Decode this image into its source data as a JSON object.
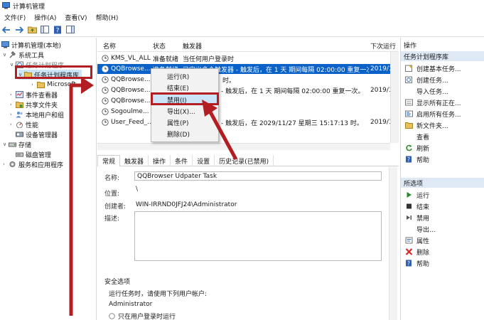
{
  "window": {
    "title": "计算机管理"
  },
  "menu": [
    "文件(F)",
    "操作(A)",
    "查看(V)",
    "帮助(H)"
  ],
  "tree": {
    "root": "计算机管理(本地)",
    "system_tools": "系统工具",
    "task_scheduler": "任务计划程序",
    "task_library": "任务计划程序库",
    "microsoft": "Microsoft",
    "event_viewer": "事件查看器",
    "shared_folders": "共享文件夹",
    "local_users": "本地用户和组",
    "performance": "性能",
    "device_manager": "设备管理器",
    "storage": "存储",
    "disk_management": "磁盘管理",
    "services_apps": "服务和应用程序"
  },
  "task_list": {
    "headers": [
      "名称",
      "状态",
      "触发器",
      "下次运行"
    ],
    "rows": [
      {
        "name": "KMS_VL_ALL",
        "status": "准备就绪",
        "trigger": "当任何用户登录时",
        "next": ""
      },
      {
        "name": "QQBrowse...",
        "status": "准备就绪",
        "trigger": "已定义多个触发器 - 触发后，在 1 天 期间每隔 02:00:00 重复一次。",
        "next": "2019/11"
      },
      {
        "name": "QQBrowse...",
        "status": "",
        "trigger": "",
        "next": ""
      },
      {
        "name": "QQBrowse...",
        "status": "",
        "trigger": "- 触发后，在 1 天 期间每隔 02:00:00 重复一次。",
        "next": "2019/11"
      },
      {
        "name": "QQBrowse...",
        "status": "",
        "trigger": "",
        "next": ""
      },
      {
        "name": "Sogoulme...",
        "status": "",
        "trigger": "",
        "next": ""
      },
      {
        "name": "User_Feed_...",
        "status": "",
        "trigger": "- 触发后，在 2029/11/27 星期三 15:17:13 时。",
        "next": "2019/11"
      }
    ],
    "row2_suffix": "时。"
  },
  "context_menu": [
    "运行(R)",
    "结束(E)",
    "禁用(I)",
    "导出(X)...",
    "属性(P)",
    "删除(D)"
  ],
  "tabs": [
    "常规",
    "触发器",
    "操作",
    "条件",
    "设置",
    "历史记录(已禁用)"
  ],
  "detail": {
    "name_label": "名称:",
    "name_value": "QQBrowser Udpater Task",
    "location_label": "位置:",
    "location_value": "\\",
    "author_label": "创建者:",
    "author_value": "WIN-IRRND0JFJ24\\Administrator",
    "desc_label": "描述:",
    "security_title": "安全选项",
    "run_as_label": "运行任务时，请使用下列用户帐户:",
    "run_as_value": "Administrator",
    "radio_logged_on": "只在用户登录时运行"
  },
  "actions": {
    "header": "操作",
    "section1": "任务计划程序库",
    "items1": [
      "创建基本任务...",
      "创建任务...",
      "导入任务...",
      "显示所有正在...",
      "启用所有任务...",
      "新文件夹...",
      "查看",
      "刷新",
      "帮助"
    ],
    "section2": "所选项",
    "items2": [
      "运行",
      "结束",
      "禁用",
      "导出...",
      "属性",
      "删除",
      "帮助"
    ]
  },
  "colors": {
    "selection": "#0a62c8",
    "annotation_red": "#b31e22",
    "actions_header": "#dfe9f5"
  }
}
